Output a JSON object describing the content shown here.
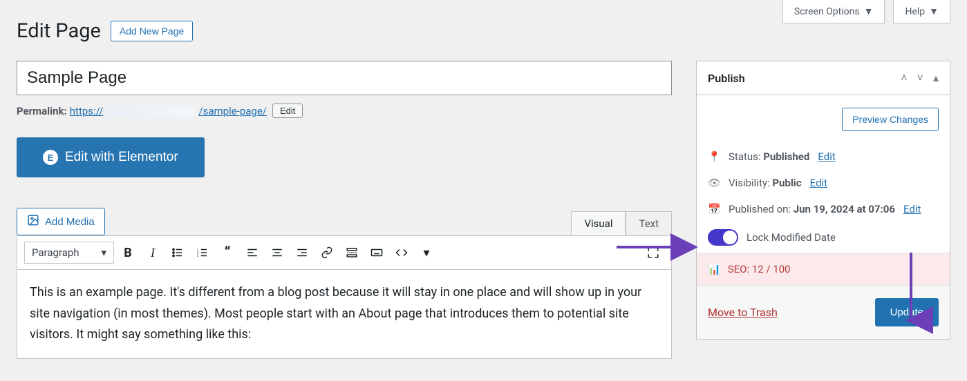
{
  "top": {
    "screen_options": "Screen Options",
    "help": "Help"
  },
  "header": {
    "title": "Edit Page",
    "add_new": "Add New Page"
  },
  "title_input_value": "Sample Page",
  "permalink": {
    "label": "Permalink:",
    "prefix": "https://",
    "slug": "/sample-page/",
    "edit_label": "Edit"
  },
  "elementor": {
    "label": "Edit with Elementor"
  },
  "media": {
    "add_media": "Add Media"
  },
  "editor_tabs": {
    "visual": "Visual",
    "text": "Text"
  },
  "toolbar": {
    "format": "Paragraph"
  },
  "editor_content": "This is an example page. It's different from a blog post because it will stay in one place and will show up in your site navigation (in most themes). Most people start with an About page that introduces them to potential site visitors. It might say something like this:",
  "publish": {
    "panel_title": "Publish",
    "preview": "Preview Changes",
    "status_label": "Status: ",
    "status_value": "Published",
    "status_edit": "Edit",
    "visibility_label": "Visibility: ",
    "visibility_value": "Public",
    "visibility_edit": "Edit",
    "published_label": "Published on: ",
    "published_value": "Jun 19, 2024 at 07:06",
    "published_edit": "Edit",
    "lock_label": "Lock Modified Date",
    "seo_label": "SEO: ",
    "seo_value": "12 / 100",
    "trash": "Move to Trash",
    "update": "Update"
  }
}
